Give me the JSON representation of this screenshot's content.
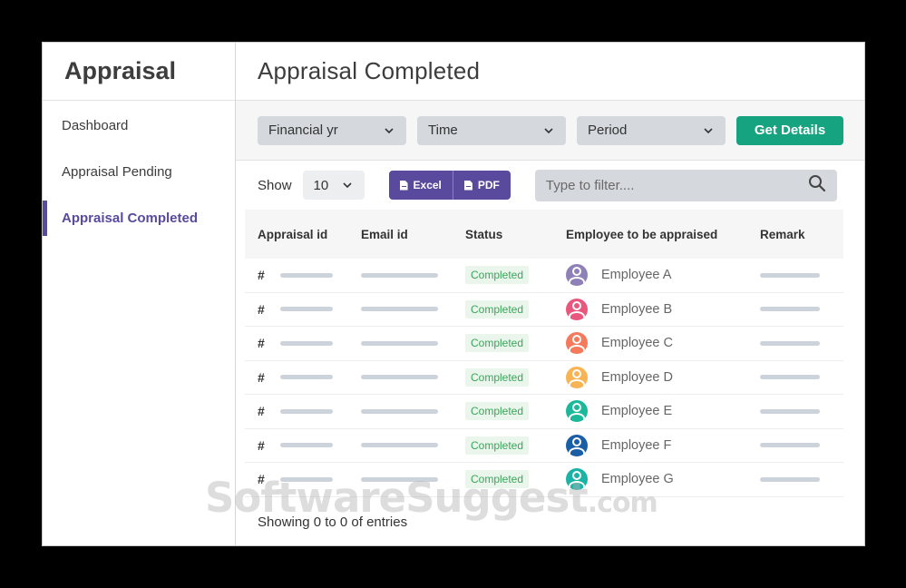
{
  "sidebar": {
    "brand": "Appraisal",
    "items": [
      {
        "label": "Dashboard",
        "active": false
      },
      {
        "label": "Appraisal Pending",
        "active": false
      },
      {
        "label": "Appraisal Completed",
        "active": true
      }
    ]
  },
  "main": {
    "title": "Appraisal Completed",
    "filters": {
      "financial_yr": "Financial yr",
      "time": "Time",
      "period": "Period",
      "get_details": "Get Details"
    },
    "toolbar": {
      "show_label": "Show",
      "page_size": "10",
      "excel_label": "Excel",
      "pdf_label": "PDF",
      "search_placeholder": "Type to filter...."
    },
    "table": {
      "headers": [
        "Appraisal id",
        "Email id",
        "Status",
        "Employee to be appraised",
        "Remark"
      ],
      "rows": [
        {
          "hash": "#",
          "status": "Completed",
          "employee": "Employee A",
          "avatar_color": "#8f80b8"
        },
        {
          "hash": "#",
          "status": "Completed",
          "employee": "Employee B",
          "avatar_color": "#e9577e"
        },
        {
          "hash": "#",
          "status": "Completed",
          "employee": "Employee C",
          "avatar_color": "#f57a5c"
        },
        {
          "hash": "#",
          "status": "Completed",
          "employee": "Employee D",
          "avatar_color": "#f8b454"
        },
        {
          "hash": "#",
          "status": "Completed",
          "employee": "Employee E",
          "avatar_color": "#1bb89a"
        },
        {
          "hash": "#",
          "status": "Completed",
          "employee": "Employee F",
          "avatar_color": "#1a5fa6"
        },
        {
          "hash": "#",
          "status": "Completed",
          "employee": "Employee G",
          "avatar_color": "#1ab3a6"
        }
      ]
    },
    "footer": "Showing 0 to 0 of entries"
  },
  "watermark": {
    "main": "SoftwareSuggest",
    "suffix": ".com"
  },
  "colors": {
    "accent": "#5a4a9d",
    "get_details": "#16a37f",
    "completed_badge_text": "#3aa55a"
  }
}
